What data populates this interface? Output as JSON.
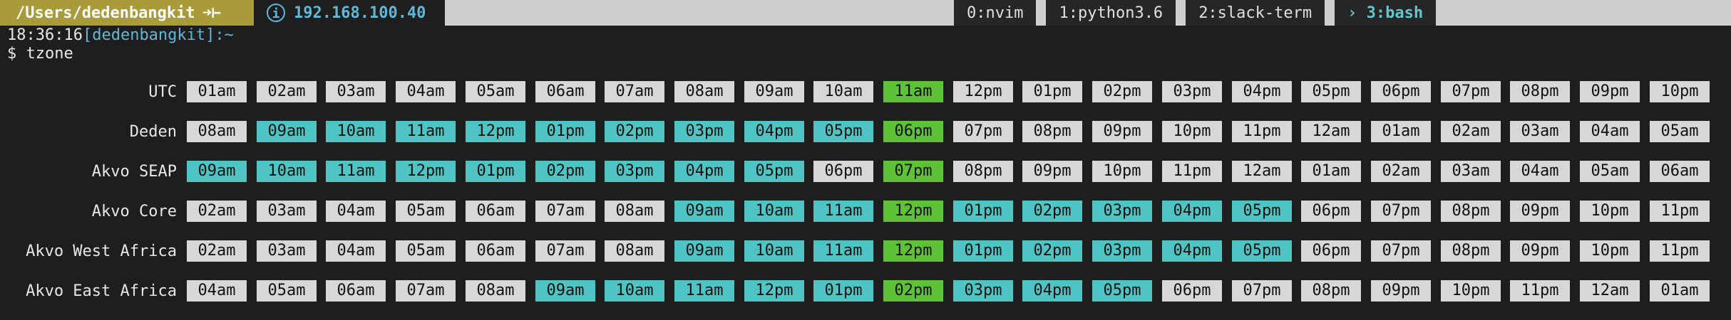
{
  "statusbar": {
    "path": "/Users/dedenbangkit",
    "path_arrow": "➜⊢",
    "ip_icon": "i",
    "ip": "192.168.100.40",
    "windows": [
      {
        "label": "0:nvim",
        "active": false
      },
      {
        "label": "1:python3.6",
        "active": false
      },
      {
        "label": "2:slack-term",
        "active": false
      },
      {
        "label": "› 3:bash",
        "active": true
      }
    ]
  },
  "prompt": {
    "time": "18:36:16",
    "user": "[dedenbangkit]:~"
  },
  "command": "$ tzone",
  "colors": {
    "idle": "#d7d7d7",
    "work": "#4fc4c4",
    "current": "#5ec236"
  },
  "timezones": [
    {
      "name": "UTC",
      "current": 10,
      "work": [],
      "hours": [
        "01am",
        "02am",
        "03am",
        "04am",
        "05am",
        "06am",
        "07am",
        "08am",
        "09am",
        "10am",
        "11am",
        "12pm",
        "01pm",
        "02pm",
        "03pm",
        "04pm",
        "05pm",
        "06pm",
        "07pm",
        "08pm",
        "09pm",
        "10pm"
      ]
    },
    {
      "name": "Deden",
      "current": 10,
      "work": [
        1,
        2,
        3,
        4,
        5,
        6,
        7,
        8,
        9
      ],
      "hours": [
        "08am",
        "09am",
        "10am",
        "11am",
        "12pm",
        "01pm",
        "02pm",
        "03pm",
        "04pm",
        "05pm",
        "06pm",
        "07pm",
        "08pm",
        "09pm",
        "10pm",
        "11pm",
        "12am",
        "01am",
        "02am",
        "03am",
        "04am",
        "05am"
      ]
    },
    {
      "name": "Akvo SEAP",
      "current": 10,
      "work": [
        0,
        1,
        2,
        3,
        4,
        5,
        6,
        7,
        8
      ],
      "hours": [
        "09am",
        "10am",
        "11am",
        "12pm",
        "01pm",
        "02pm",
        "03pm",
        "04pm",
        "05pm",
        "06pm",
        "07pm",
        "08pm",
        "09pm",
        "10pm",
        "11pm",
        "12am",
        "01am",
        "02am",
        "03am",
        "04am",
        "05am",
        "06am"
      ]
    },
    {
      "name": "Akvo Core",
      "current": 10,
      "work": [
        7,
        8,
        9,
        11,
        12,
        13,
        14,
        15
      ],
      "hours": [
        "02am",
        "03am",
        "04am",
        "05am",
        "06am",
        "07am",
        "08am",
        "09am",
        "10am",
        "11am",
        "12pm",
        "01pm",
        "02pm",
        "03pm",
        "04pm",
        "05pm",
        "06pm",
        "07pm",
        "08pm",
        "09pm",
        "10pm",
        "11pm"
      ]
    },
    {
      "name": "Akvo West Africa",
      "current": 10,
      "work": [
        7,
        8,
        9,
        11,
        12,
        13,
        14,
        15
      ],
      "hours": [
        "02am",
        "03am",
        "04am",
        "05am",
        "06am",
        "07am",
        "08am",
        "09am",
        "10am",
        "11am",
        "12pm",
        "01pm",
        "02pm",
        "03pm",
        "04pm",
        "05pm",
        "06pm",
        "07pm",
        "08pm",
        "09pm",
        "10pm",
        "11pm"
      ]
    },
    {
      "name": "Akvo East Africa",
      "current": 10,
      "work": [
        5,
        6,
        7,
        8,
        9,
        11,
        12,
        13
      ],
      "hours": [
        "04am",
        "05am",
        "06am",
        "07am",
        "08am",
        "09am",
        "10am",
        "11am",
        "12pm",
        "01pm",
        "02pm",
        "03pm",
        "04pm",
        "05pm",
        "06pm",
        "07pm",
        "08pm",
        "09pm",
        "10pm",
        "11pm",
        "12am",
        "01am"
      ]
    }
  ]
}
